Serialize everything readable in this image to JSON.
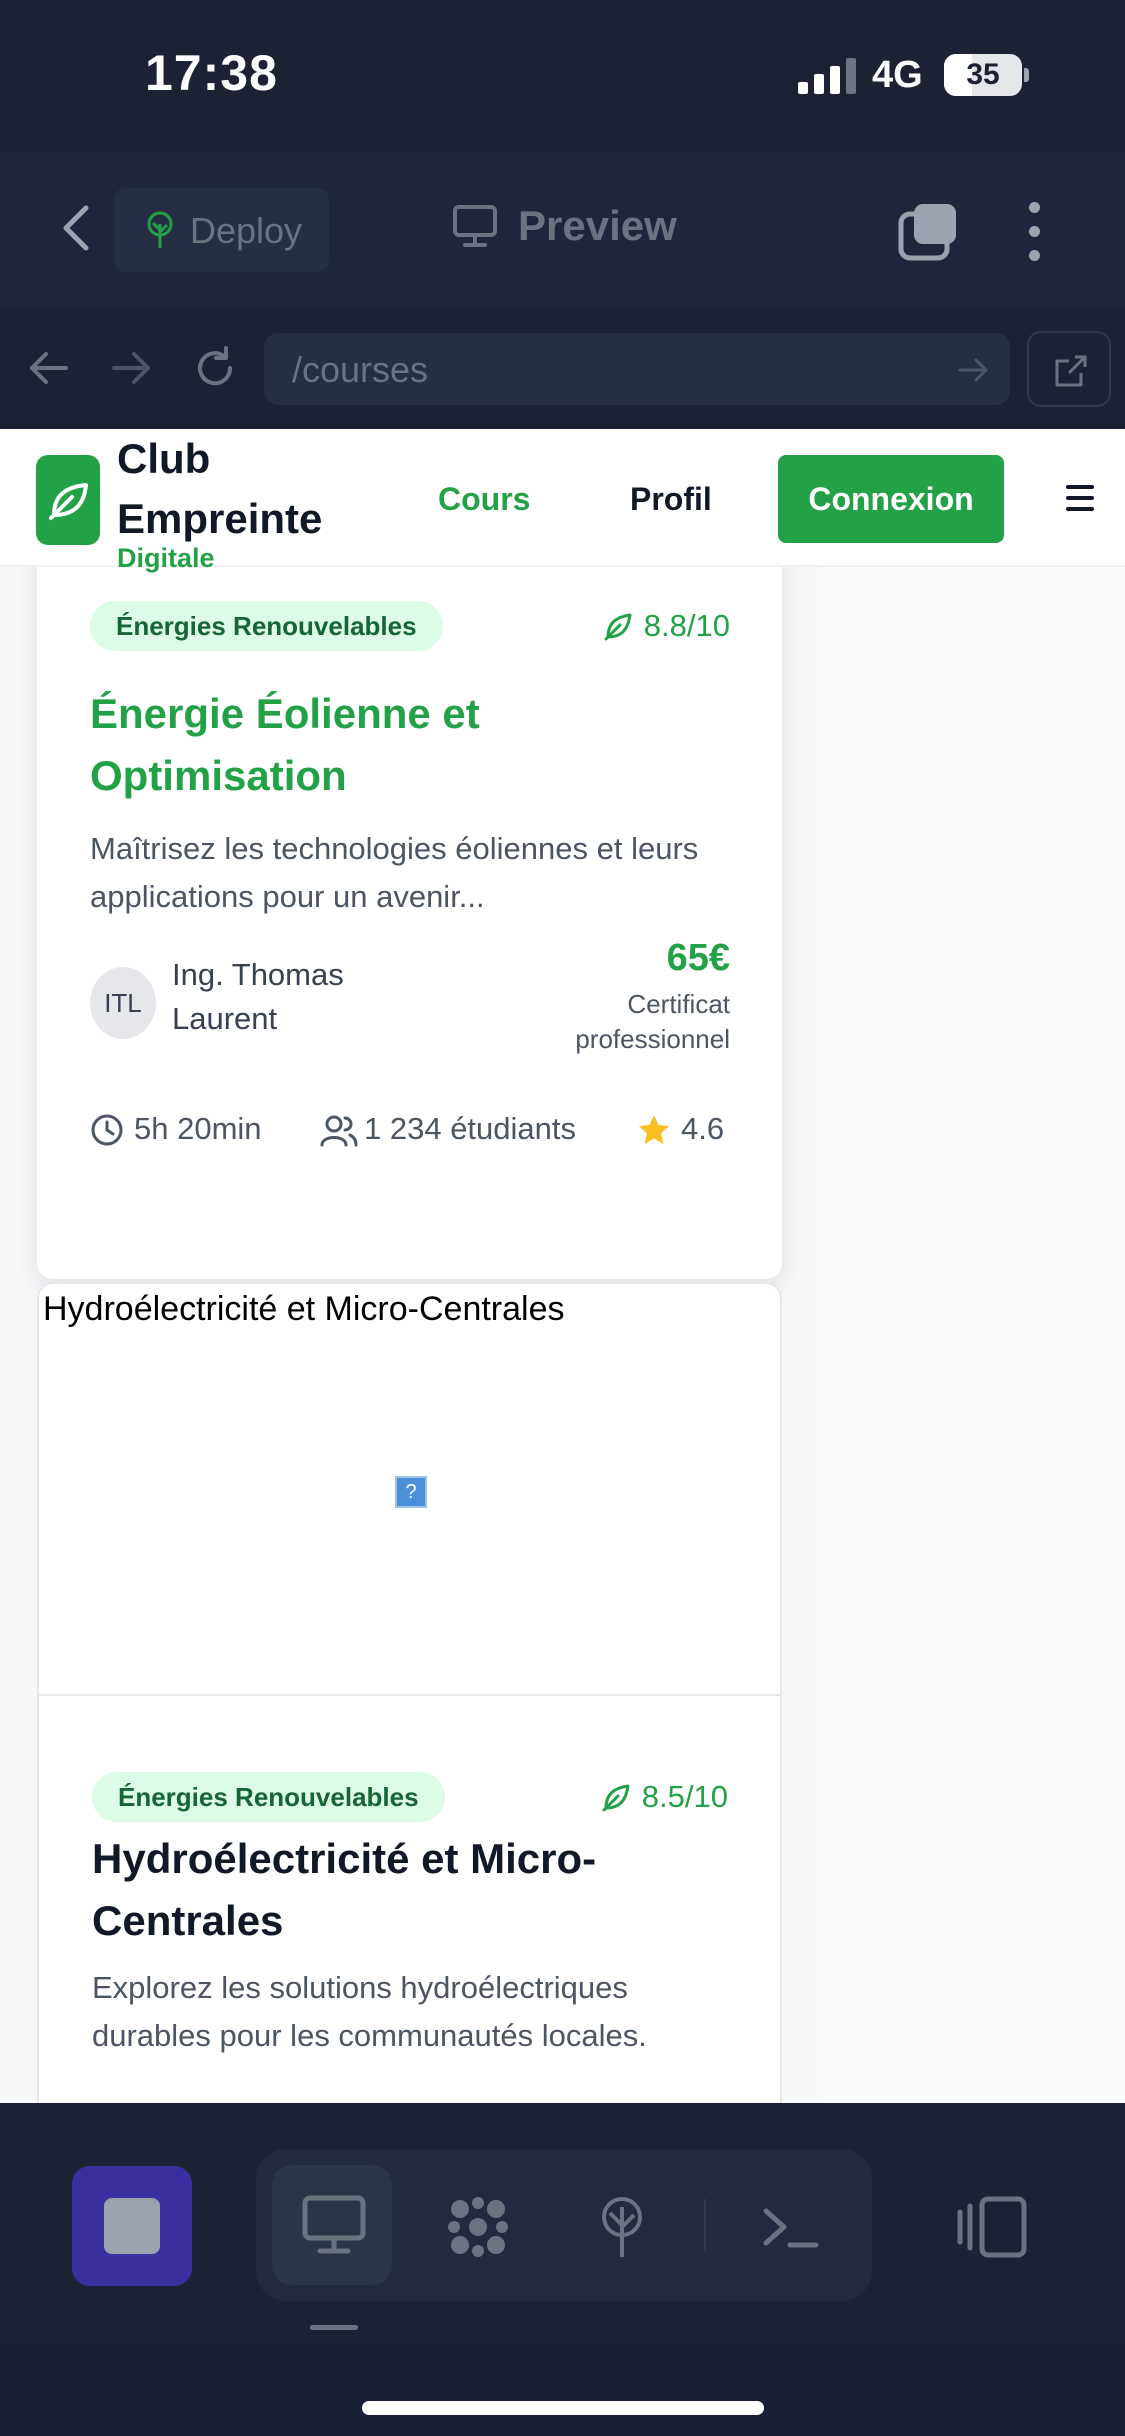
{
  "status_bar": {
    "time": "17:38",
    "network": "4G",
    "battery": "35"
  },
  "toolbar": {
    "deploy_label": "Deploy",
    "preview_label": "Preview"
  },
  "browser": {
    "url": "/courses"
  },
  "site": {
    "brand_title": "Club Empreinte",
    "brand_subtitle": "Digitale",
    "nav": {
      "courses": "Cours",
      "profile": "Profil",
      "login": "Connexion"
    },
    "accent_color": "#22a146"
  },
  "courses": [
    {
      "category": "Énergies Renouvelables",
      "score": "8.8/10",
      "title": "Énergie Éolienne et Optimisation",
      "description": "Maîtrisez les technologies éoliennes et leurs applications pour un avenir...",
      "instructor_initials": "ITL",
      "instructor": "Ing. Thomas Laurent",
      "price": "65€",
      "certificate": "Certificat professionnel",
      "duration": "5h 20min",
      "students": "1 234 étudiants",
      "rating": "4.6"
    },
    {
      "image_alt": "Hydroélectricité et Micro-Centrales",
      "image_broken_glyph": "?",
      "category": "Énergies Renouvelables",
      "score": "8.5/10",
      "title": "Hydroélectricité et Micro-Centrales",
      "description": "Explorez les solutions hydroélectriques durables pour les communautés locales."
    }
  ]
}
